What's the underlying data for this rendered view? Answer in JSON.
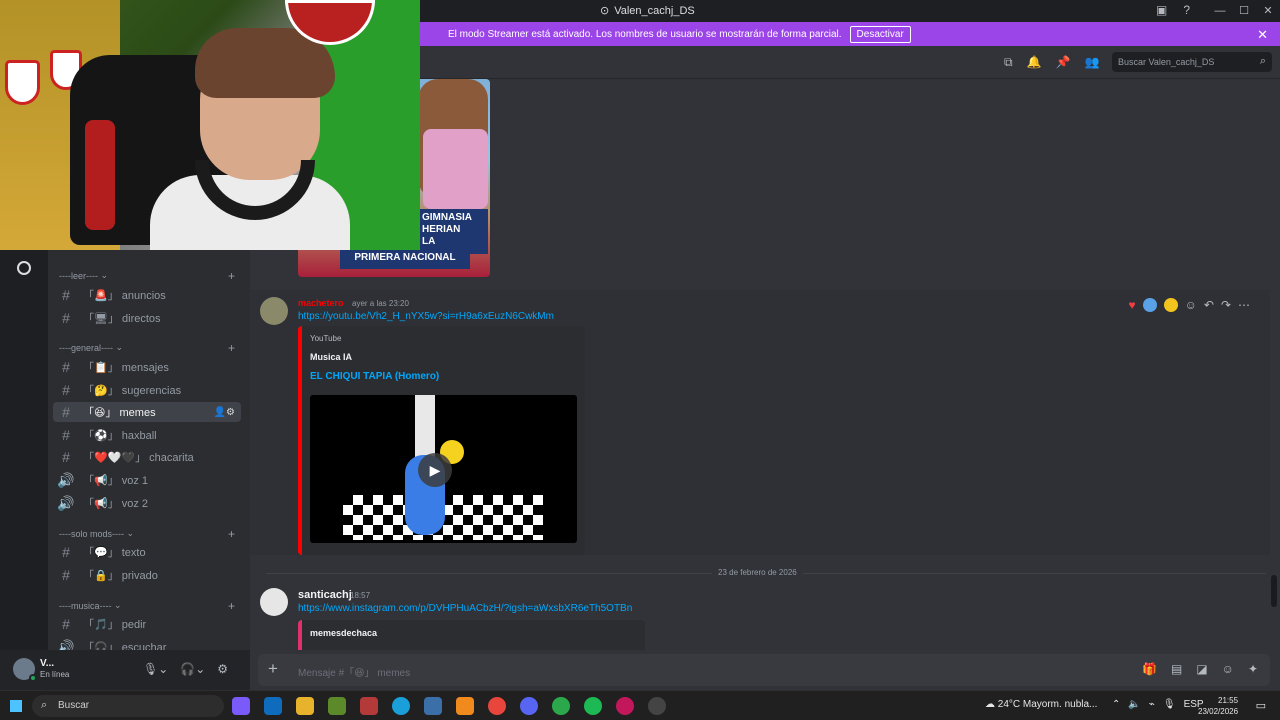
{
  "window": {
    "title": "Valen_cachj_DS"
  },
  "banner": {
    "text": "El modo Streamer está activado. Los nombres de usuario se mostrarán de forma parcial.",
    "button": "Desactivar"
  },
  "header": {
    "search_placeholder": "Buscar Valen_cachj_DS"
  },
  "preview_image": {
    "caption_line1": "GIMNASIA",
    "caption_line2": "HERIAN",
    "caption_line3": "LA",
    "caption_main": "PRIMERA NACIONAL"
  },
  "sidebar": {
    "categories": [
      {
        "label": "----leer----"
      },
      {
        "label": "----general----"
      },
      {
        "label": "----solo mods----"
      },
      {
        "label": "----musica----"
      }
    ],
    "channels": [
      {
        "label": "「🚨」 anuncios"
      },
      {
        "label": "「🖥」 directos"
      },
      {
        "label": "「📋」 mensajes"
      },
      {
        "label": "「🤔」 sugerencias"
      },
      {
        "label": "「😆」 memes"
      },
      {
        "label": "「⚽」 haxball"
      },
      {
        "label": "「❤️🤍🖤」 chacarita"
      },
      {
        "label": "「📢」 voz 1"
      },
      {
        "label": "「📢」 voz 2"
      },
      {
        "label": "「💬」 texto"
      },
      {
        "label": "「🔒」 privado"
      },
      {
        "label": "「🎵」 pedir"
      },
      {
        "label": "「🎧」 escuchar"
      }
    ]
  },
  "messages": [
    {
      "author": "machetero",
      "timestamp": "ayer a las 23:20",
      "link": "https://youtu.be/Vh2_H_nYX5w?si=rH9a6xEuzN6CwkMm",
      "embed": {
        "provider": "YouTube",
        "channel": "Musica IA",
        "title": "EL CHIQUI TAPIA  (Homero)"
      }
    },
    {
      "author": "santicachj",
      "timestamp": "18:57",
      "link": "https://www.instagram.com/p/DVHPHuACbzH/?igsh=aWxsbXR6eTh5OTBn",
      "embed": {
        "account": "memesdechaca"
      }
    }
  ],
  "date_divider": "23 de febrero de 2026",
  "composer": {
    "placeholder": "Mensaje #「😆」 memes"
  },
  "user": {
    "name": "V...",
    "status": "En línea"
  },
  "taskbar": {
    "search": "Buscar",
    "weather": "24°C  Mayorm. nubla...",
    "lang": "ESP",
    "time": "21:55",
    "date": "23/02/2026"
  }
}
